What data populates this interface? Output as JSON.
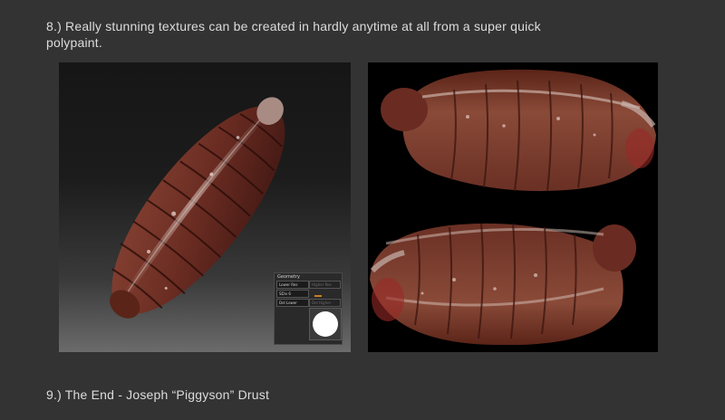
{
  "steps": {
    "step8": "8.) Really stunning textures can be created in hardly anytime at all from a super quick polypaint.",
    "step9": "9.) The End - Joseph “Piggyson” Drust"
  },
  "images": {
    "left": "polypainted-model-viewport",
    "right": "texture-map"
  },
  "geometry_palette": {
    "title": "Geometry",
    "buttons": [
      "Lower Res",
      "Higher Res",
      "SDiv 6",
      "Del Lower",
      "Del Higher"
    ],
    "swatch_color": "#ffffff",
    "slider_color": "#d07a22"
  },
  "colors": {
    "background": "#333333",
    "text": "#dcdcdc",
    "flesh_dark": "#3a1410",
    "flesh_mid": "#7a3a2c",
    "flesh_light": "#b07060"
  }
}
